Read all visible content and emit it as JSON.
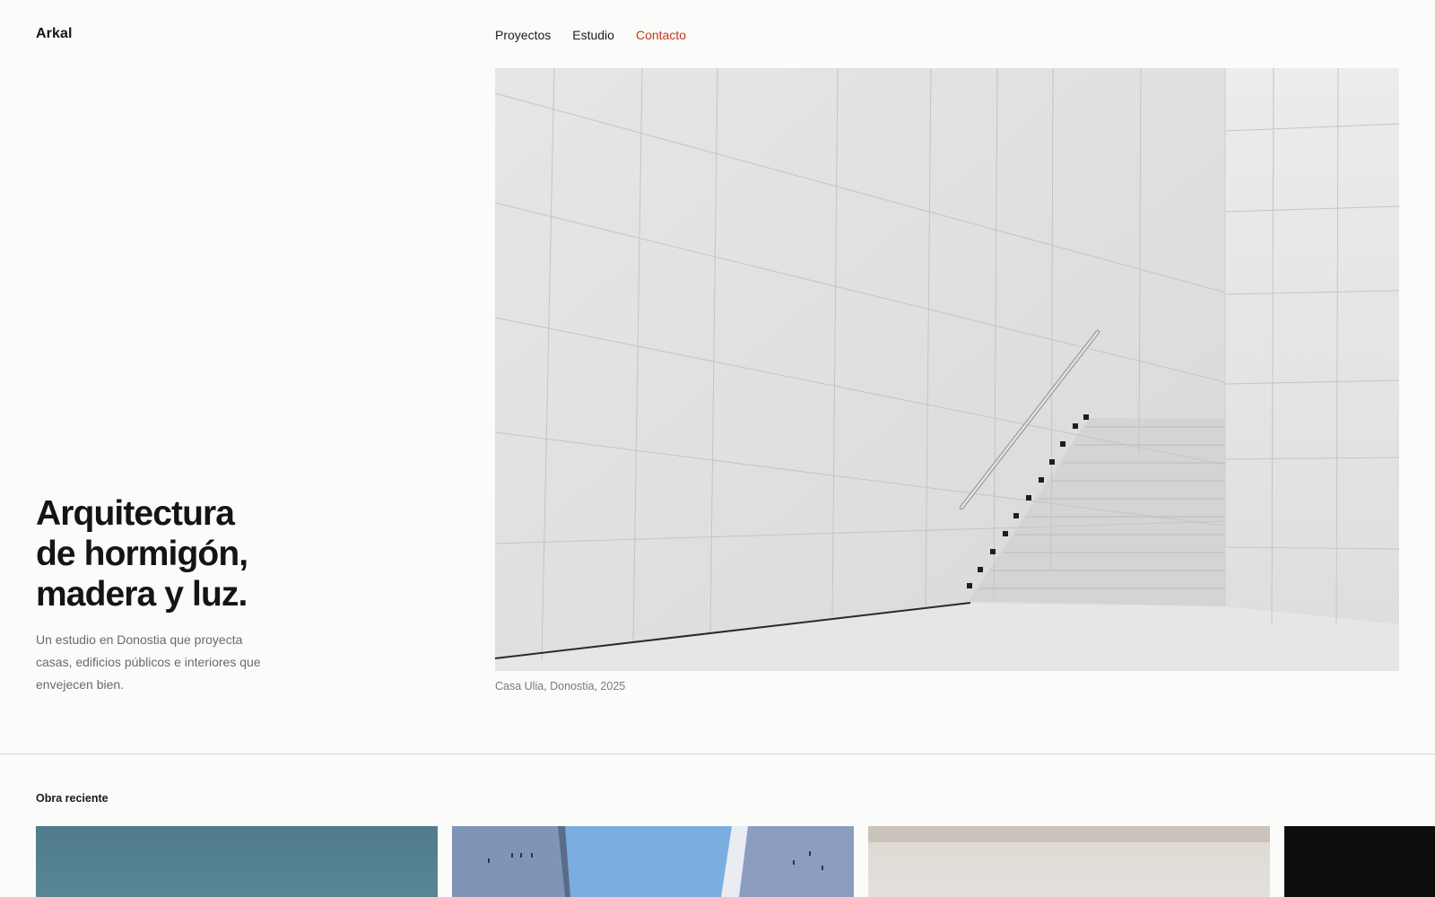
{
  "brand": {
    "name": "Arkal"
  },
  "nav": {
    "items": [
      {
        "label": "Proyectos",
        "active": false
      },
      {
        "label": "Estudio",
        "active": false
      },
      {
        "label": "Contacto",
        "active": true
      }
    ],
    "active_color": "#c2361a"
  },
  "hero": {
    "title_lines": [
      "Arquitectura",
      "de hormigón,",
      "madera y luz."
    ],
    "description_lines": [
      "Un estudio en Donostia que proyecta",
      "casas, edificios públicos e interiores que",
      "envejecen bien."
    ],
    "caption": "Casa Ulia, Donostia, 2025"
  },
  "recent": {
    "title": "Obra reciente"
  },
  "colors": {
    "background": "#fbfbf9",
    "text": "#161616",
    "muted": "#6a6a6a",
    "accent": "#c2361a"
  }
}
